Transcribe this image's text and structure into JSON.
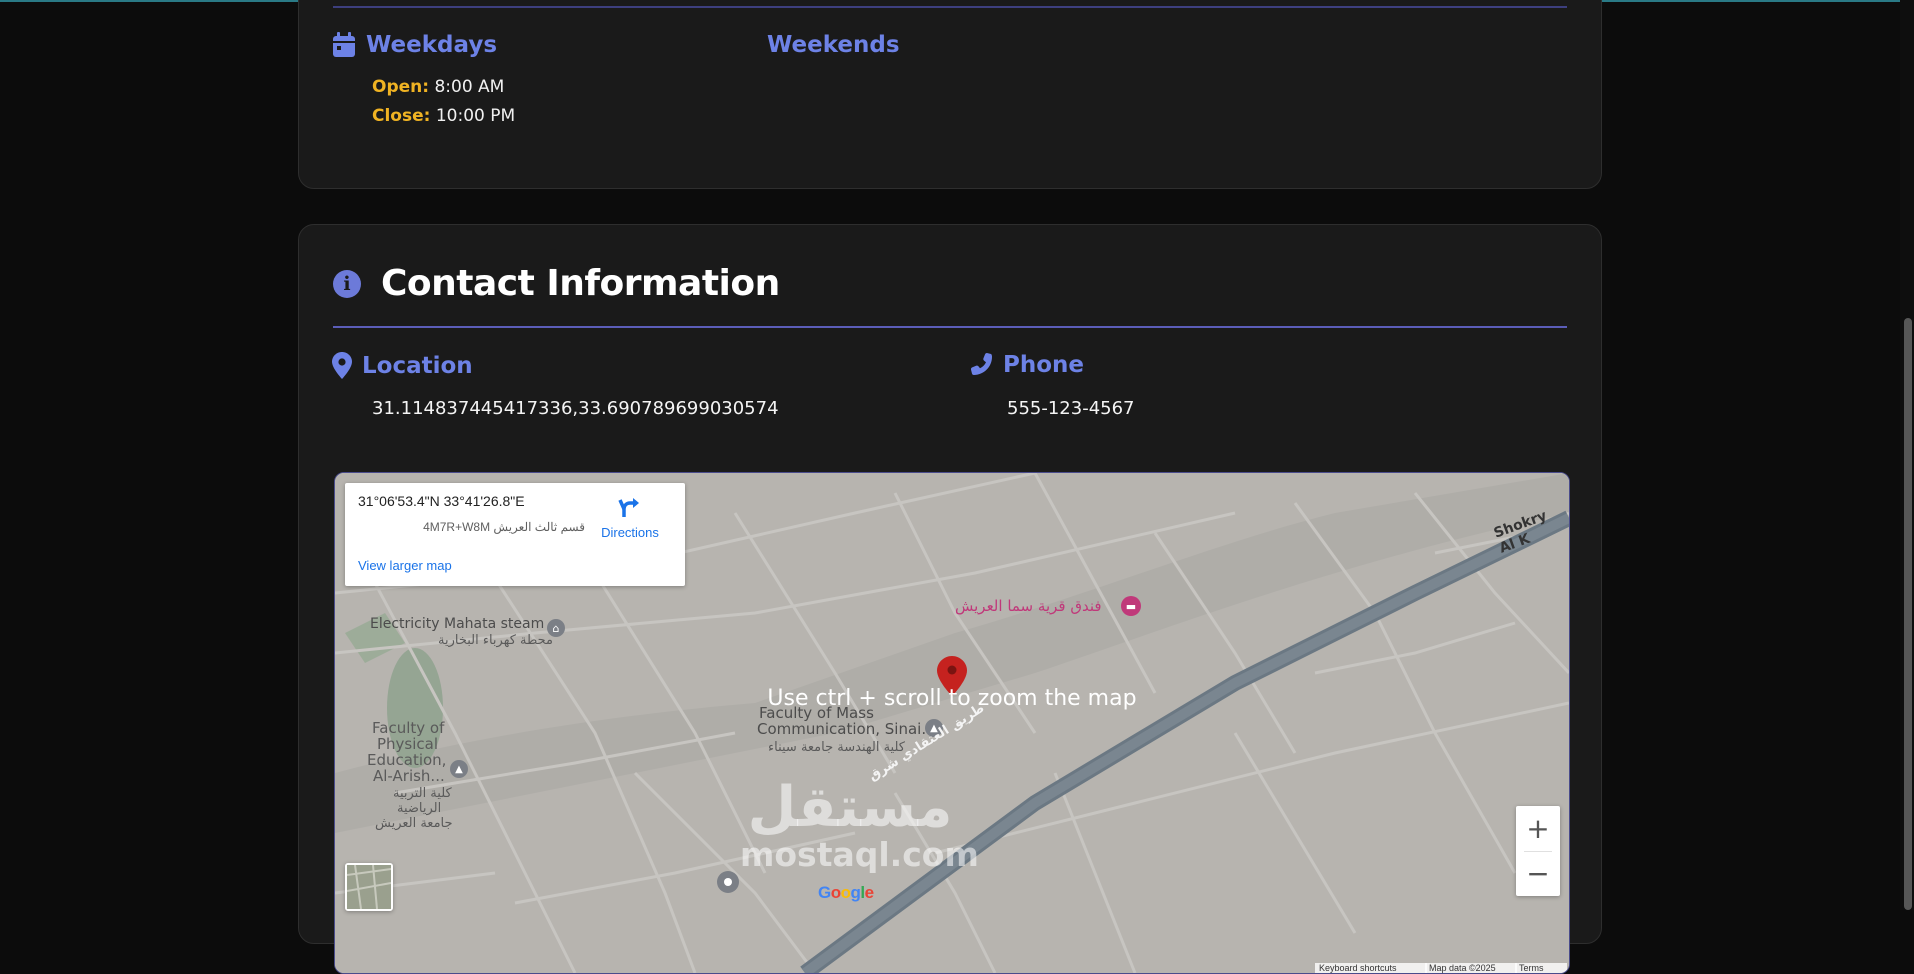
{
  "hours": {
    "weekdays_title": "Weekdays",
    "weekends_title": "Weekends",
    "open_label": "Open:",
    "open_time": "8:00 AM",
    "close_label": "Close:",
    "close_time": "10:00 PM"
  },
  "contact": {
    "title": "Contact Information",
    "info_icon_glyph": "i",
    "location_title": "Location",
    "location_value": "31.114837445417336,33.690789699030574",
    "phone_title": "Phone",
    "phone_value": "555-123-4567"
  },
  "map": {
    "coordinates": "31°06'53.4\"N 33°41'26.8\"E",
    "plus_code": "4M7R+W8M قسم ثالث العريش",
    "directions_label": "Directions",
    "view_larger": "View larger map",
    "hint": "Use ctrl + scroll to zoom the map",
    "zoom_in": "+",
    "zoom_out": "−",
    "places": {
      "electricity_en": "Electricity Mahata steam",
      "electricity_ar": "محطة كهرباء البخارية",
      "hotel_ar": "فندق قرية سما العريش",
      "faculty_mass_1": "Faculty of Mass",
      "faculty_mass_2": "Communication, Sinai...",
      "faculty_eng_ar": "كلية الهندسة جامعة سيناء",
      "pe_1": "Faculty of",
      "pe_2": "Physical",
      "pe_3": "Education,",
      "pe_4": "Al-Arish...",
      "pe_ar_1": "كلية التربية",
      "pe_ar_2": "الرياضية",
      "pe_ar_3": "جامعة العريش",
      "road_shokry": "Shokry Al K",
      "road_ar": "طريق العتقادي شرق"
    },
    "google": [
      "G",
      "o",
      "o",
      "g",
      "l",
      "e"
    ],
    "attribution": [
      "Keyboard shortcuts",
      "Map data ©2025",
      "Terms"
    ],
    "watermark_ar": "مستقل",
    "watermark_en": "mostaql.com"
  },
  "colors": {
    "accent_blue": "#6d82e6",
    "label_gold": "#f0b323",
    "divider": "#5b5db8",
    "pin_red": "#c5221f"
  },
  "icons": [
    "calendar-icon",
    "info-icon",
    "location-pin-icon",
    "phone-icon",
    "directions-icon",
    "map-pin-icon",
    "hotel-icon",
    "school-icon"
  ]
}
